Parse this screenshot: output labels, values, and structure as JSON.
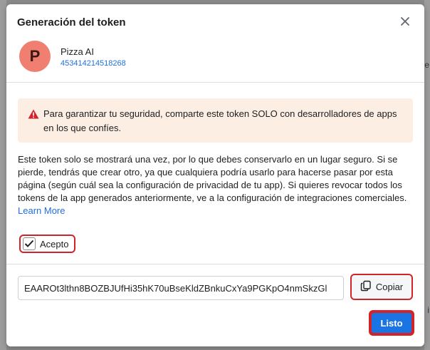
{
  "modal": {
    "title": "Generación del token",
    "close_icon": "close-icon"
  },
  "app": {
    "avatar_letter": "P",
    "name": "Pizza AI",
    "id": "453414214518268",
    "avatar_color": "#f07f72"
  },
  "warning": {
    "icon": "warning-triangle-icon",
    "text": "Para garantizar tu seguridad, comparte este token SOLO con desarrolladores de apps en los que confíes.",
    "background": "#fdeee3"
  },
  "description": {
    "text": "Este token solo se mostrará una vez, por lo que debes conservarlo en un lugar seguro. Si se pierde, tendrás que crear otro, ya que cualquiera podría usarlo para hacerse pasar por esta página (según cuál sea la configuración de privacidad de tu app). Si quieres revocar todos los tokens de la app generados anteriormente, ve a la configuración de integraciones comerciales.",
    "learn_more": "Learn More"
  },
  "accept": {
    "label": "Acepto",
    "checked": true
  },
  "token": {
    "value": "EAAROt3lthn8BOZBJUfHi35hK70uBseKldZBnkuCxYa9PGKpO4nmSkzGl"
  },
  "buttons": {
    "copy_label": "Copiar",
    "done_label": "Listo"
  },
  "colors": {
    "primary": "#1b74e4",
    "highlight": "#d0232a",
    "link": "#216fdb"
  }
}
